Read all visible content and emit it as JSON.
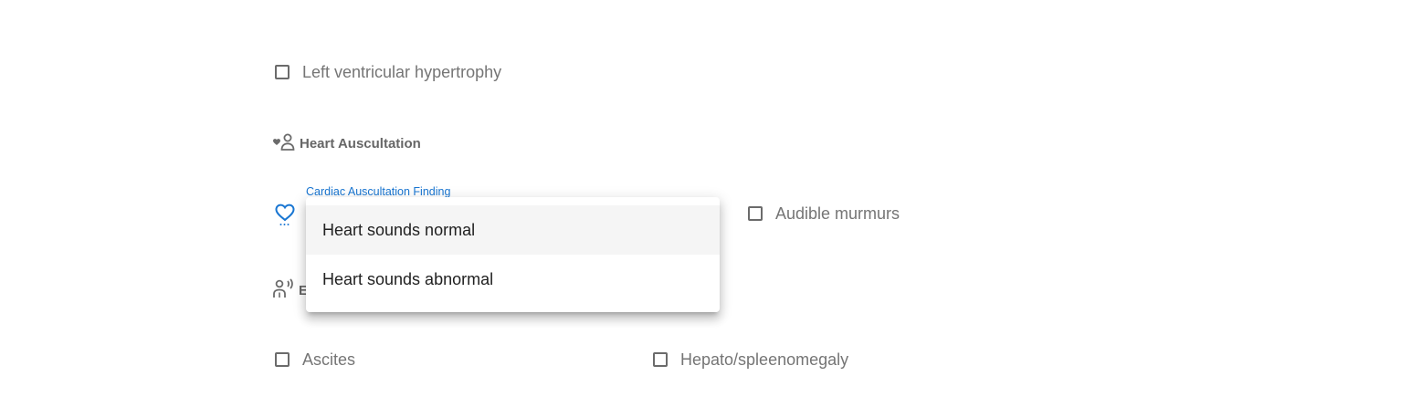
{
  "left_ventricular": {
    "label": "Left ventricular hypertrophy",
    "checked": false
  },
  "heart_auscultation": {
    "title": "Heart Auscultation",
    "icon": "heart-person-icon",
    "field_label": "Cardiac Auscultation Finding",
    "field_icon": "heart-icon",
    "options": [
      {
        "label": "Heart sounds normal",
        "highlighted": true
      },
      {
        "label": "Heart sounds abnormal",
        "highlighted": false
      }
    ],
    "audible_murmurs": {
      "label": "Audible murmurs",
      "checked": false
    }
  },
  "abdomen_section": {
    "title_visible_fragment": "E",
    "icon": "person-sound-icon"
  },
  "ascites": {
    "label": "Ascites",
    "checked": false
  },
  "hepato": {
    "label": "Hepato/spleenomegaly",
    "checked": false
  },
  "colors": {
    "accent": "#1976d2",
    "text_muted": "#757575",
    "highlight_bg": "#f5f5f5"
  }
}
